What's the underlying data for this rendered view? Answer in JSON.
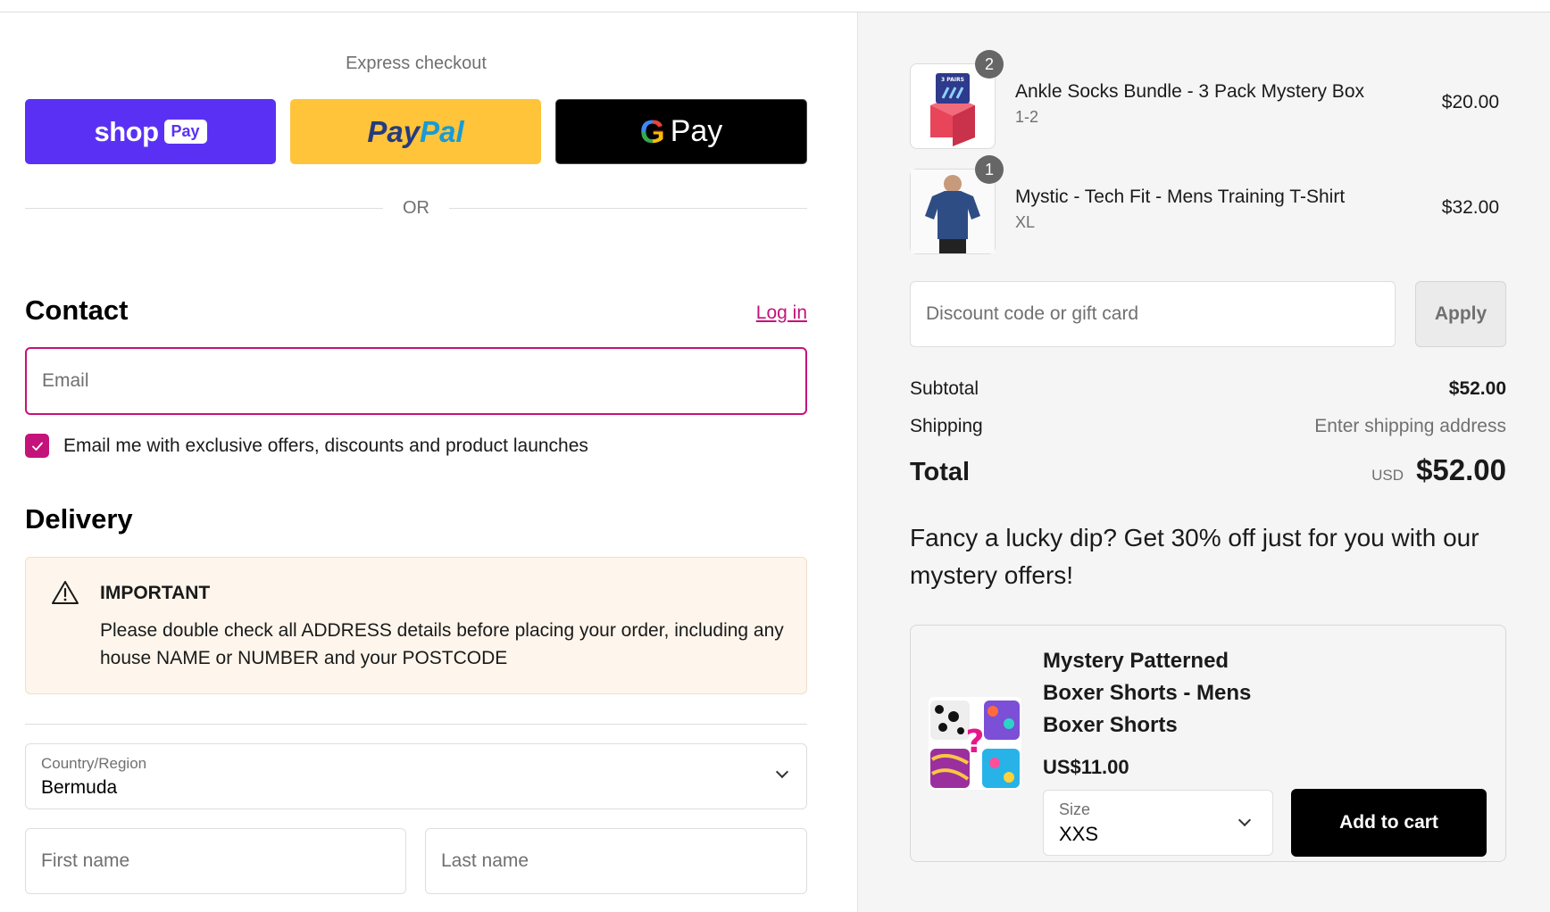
{
  "express": {
    "title": "Express checkout",
    "shop_pay": {
      "word": "shop",
      "badge": "Pay"
    },
    "paypal": {
      "part1": "Pay",
      "part2": "Pal"
    },
    "gpay": {
      "g": "G",
      "word": "Pay"
    },
    "or_text": "OR"
  },
  "contact": {
    "heading": "Contact",
    "login_label": "Log in",
    "email_placeholder": "Email",
    "marketing_label": "Email me with exclusive offers, discounts and product launches",
    "marketing_checked": true
  },
  "delivery": {
    "heading": "Delivery",
    "notice_title": "IMPORTANT",
    "notice_body": "Please double check all ADDRESS details before placing your order, including any house NAME or NUMBER and your POSTCODE",
    "country_label": "Country/Region",
    "country_value": "Bermuda",
    "first_name_placeholder": "First name",
    "last_name_placeholder": "Last name"
  },
  "cart": {
    "items": [
      {
        "name": "Ankle Socks Bundle - 3 Pack Mystery Box",
        "variant": "1-2",
        "price": "$20.00",
        "qty": "2",
        "thumb_text": "3 PAIRS"
      },
      {
        "name": "Mystic - Tech Fit - Mens Training T-Shirt",
        "variant": "XL",
        "price": "$32.00",
        "qty": "1"
      }
    ],
    "discount_placeholder": "Discount code or gift card",
    "apply_label": "Apply"
  },
  "summary": {
    "subtotal_label": "Subtotal",
    "subtotal_value": "$52.00",
    "shipping_label": "Shipping",
    "shipping_value": "Enter shipping address",
    "total_label": "Total",
    "currency": "USD",
    "total_value": "$52.00"
  },
  "upsell": {
    "headline": "Fancy a lucky dip? Get 30% off just for you with our mystery offers!",
    "product_title": "Mystery Patterned Boxer Shorts - Mens Boxer Shorts",
    "price": "US$11.00",
    "size_label": "Size",
    "size_value": "XXS",
    "add_label": "Add to cart"
  },
  "colors": {
    "accent": "#c4137a",
    "shop_pay": "#5a31f4",
    "paypal": "#ffc439",
    "summary_bg": "#f5f5f5"
  }
}
